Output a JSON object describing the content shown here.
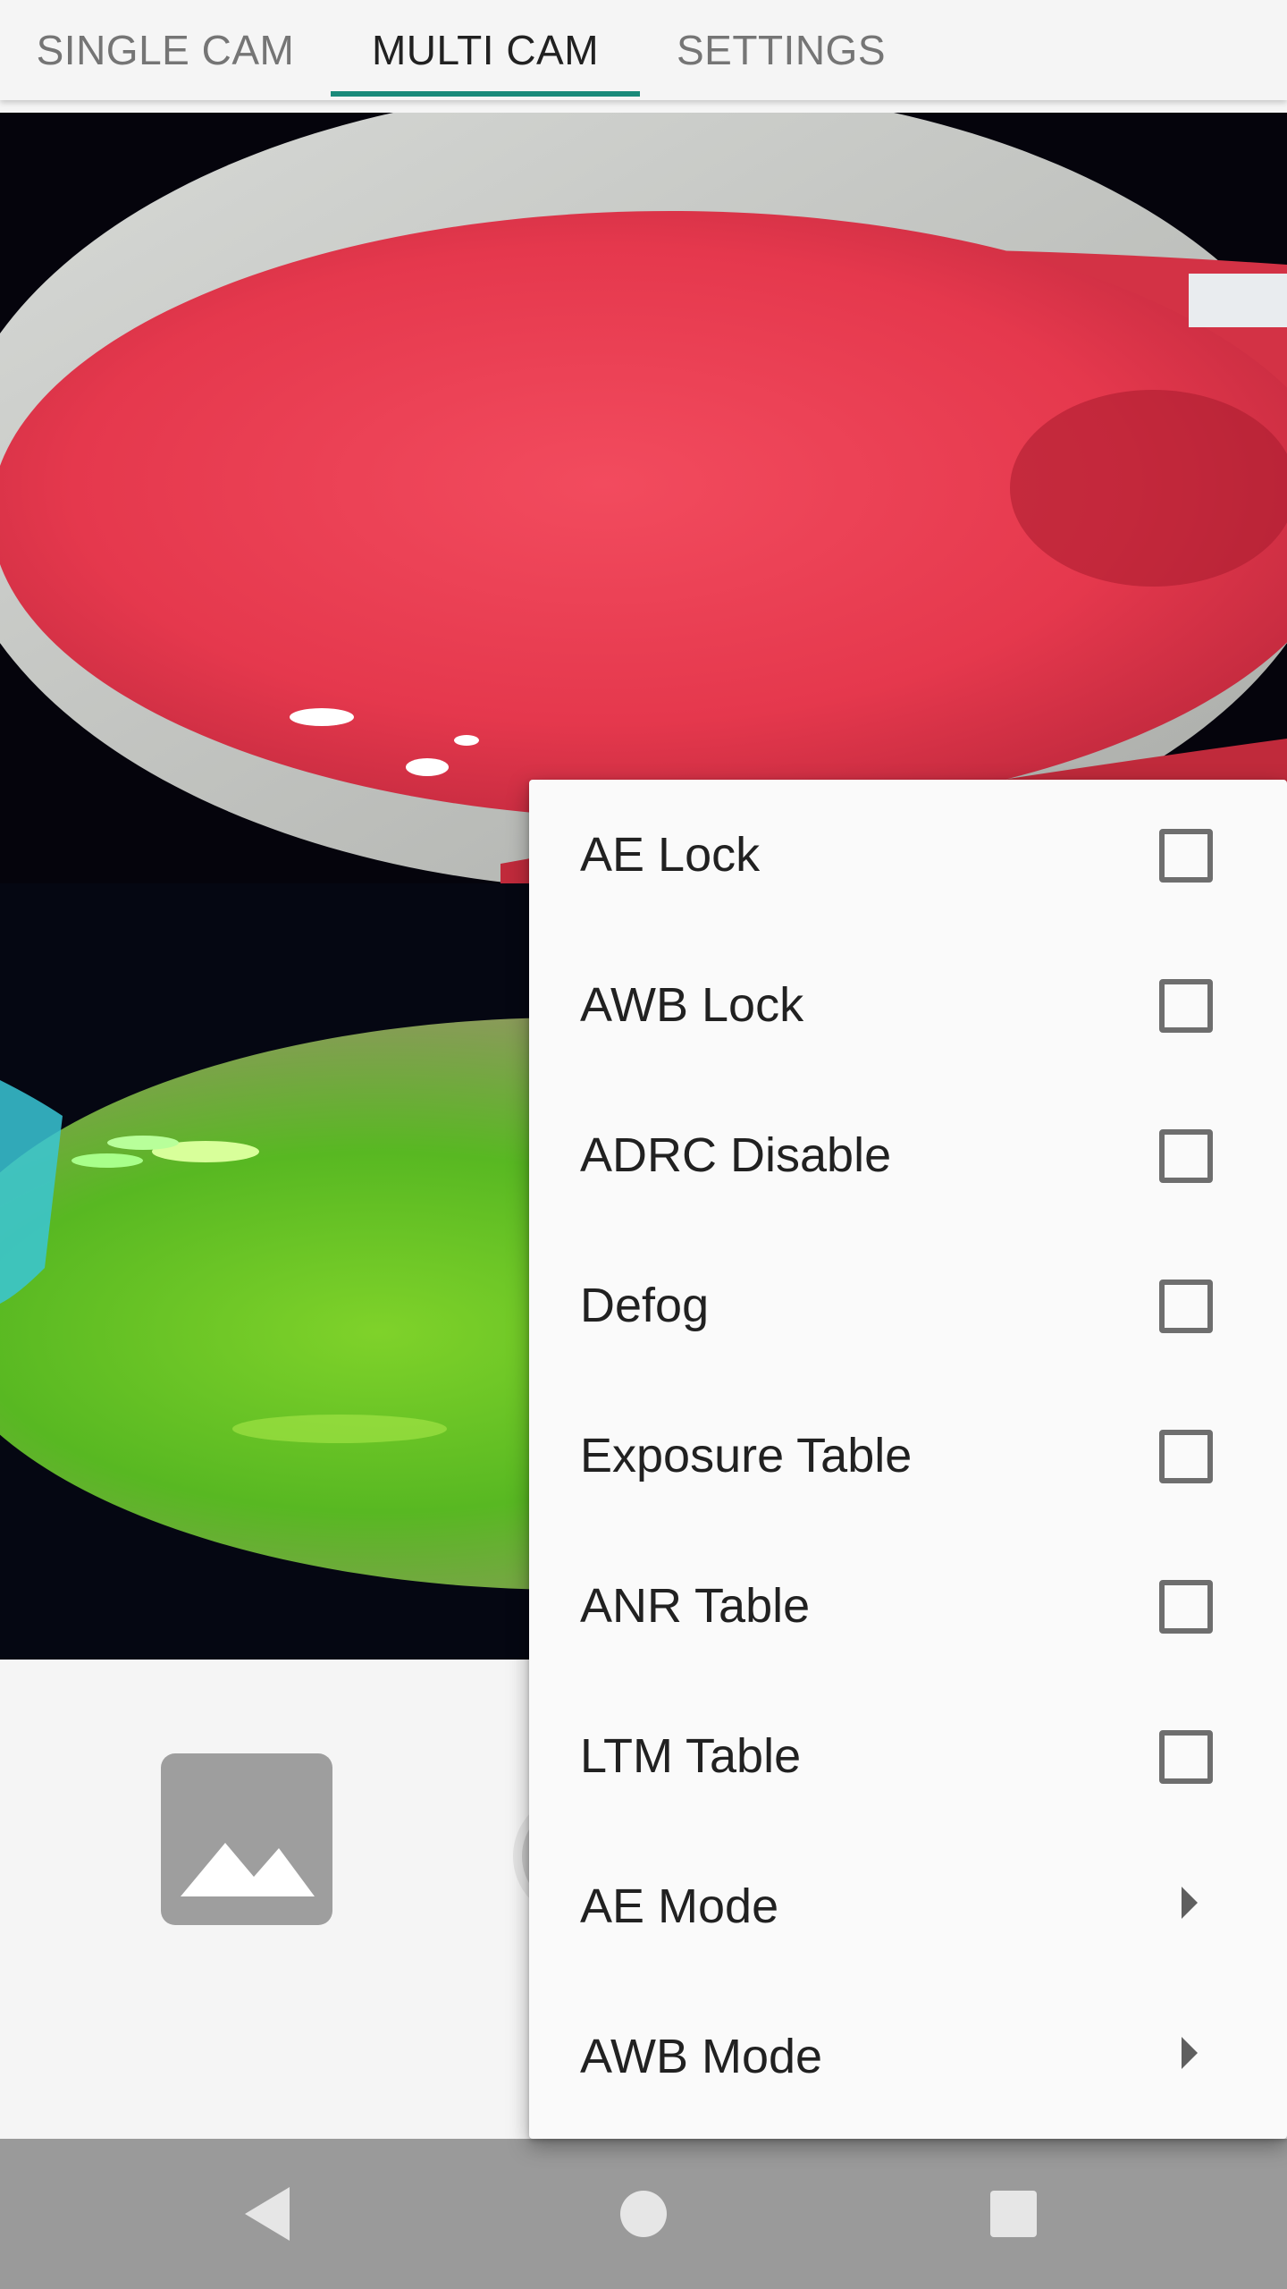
{
  "tabs": [
    {
      "label": "SINGLE CAM",
      "active": false
    },
    {
      "label": "MULTI CAM",
      "active": true
    },
    {
      "label": "SETTINGS",
      "active": false
    }
  ],
  "colors": {
    "accent": "#1a8a7a",
    "menu_background": "#fafafa",
    "navbar": "#9a9a9a"
  },
  "controls": {
    "gallery_icon": "image-icon",
    "shutter": "shutter-button"
  },
  "menu": {
    "items": [
      {
        "label": "AE Lock",
        "type": "checkbox",
        "checked": false
      },
      {
        "label": "AWB Lock",
        "type": "checkbox",
        "checked": false
      },
      {
        "label": "ADRC Disable",
        "type": "checkbox",
        "checked": false
      },
      {
        "label": "Defog",
        "type": "checkbox",
        "checked": false
      },
      {
        "label": "Exposure Table",
        "type": "checkbox",
        "checked": false
      },
      {
        "label": "ANR Table",
        "type": "checkbox",
        "checked": false
      },
      {
        "label": "LTM Table",
        "type": "checkbox",
        "checked": false
      },
      {
        "label": "AE Mode",
        "type": "submenu"
      },
      {
        "label": "AWB Mode",
        "type": "submenu"
      }
    ]
  },
  "navbar": {
    "icons": [
      "back-icon",
      "home-icon",
      "recents-icon"
    ]
  }
}
